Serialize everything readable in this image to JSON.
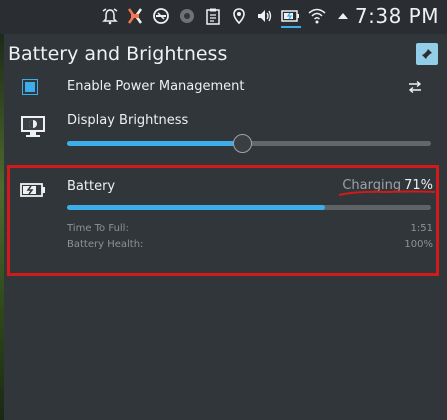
{
  "panel": {
    "clock": "7:38 PM",
    "tray_icons": [
      "alarm-icon",
      "sync-icon",
      "no-entry-icon",
      "unavailable-icon",
      "clipboard-icon",
      "location-pin-icon",
      "volume-icon",
      "battery-tray-icon",
      "wifi-icon",
      "expand-up-icon"
    ]
  },
  "popup": {
    "title": "Battery and Brightness",
    "power_management": {
      "label": "Enable Power Management",
      "checked": true
    },
    "brightness": {
      "label": "Display Brightness",
      "level": 0.48
    },
    "battery": {
      "label": "Battery",
      "status": "Charging",
      "percent": "71%",
      "fill": 0.71,
      "time_label": "Time To Full:",
      "time_value": "1:51",
      "health_label": "Battery Health:",
      "health_value": "100%"
    }
  },
  "colors": {
    "accent": "#3daee9",
    "highlight_box": "#d11a1a",
    "background": "#31363b"
  }
}
